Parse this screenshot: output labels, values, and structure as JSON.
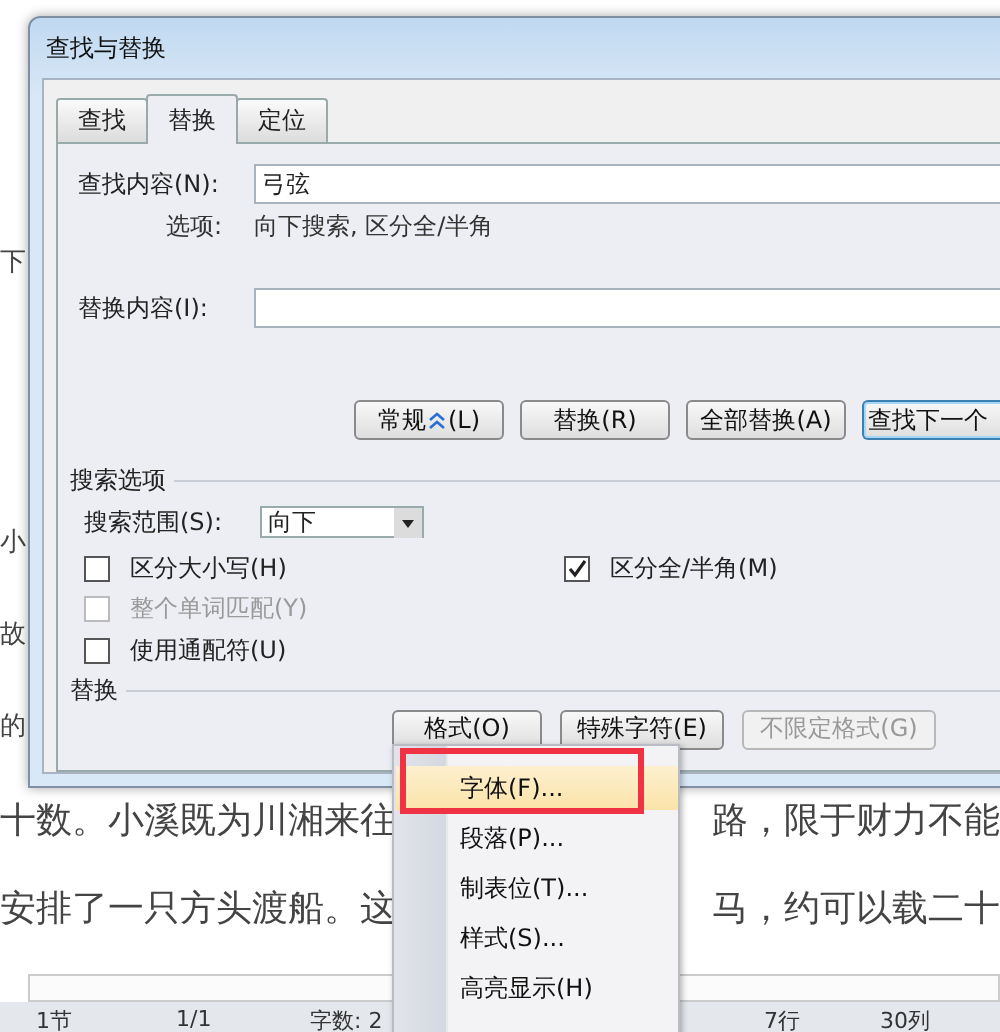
{
  "document": {
    "margin_chars": [
      "下",
      "小",
      "故",
      "的"
    ],
    "lines": [
      {
        "left": "十数。小溪既为川湘来往",
        "right": "路，限于财力不能"
      },
      {
        "left": "安排了一只方头渡船。这",
        "right": "马，约可以载二十"
      }
    ]
  },
  "status_bar": [
    "1节",
    "1/1",
    "字数: 2",
    "7行",
    "30列"
  ],
  "dialog": {
    "title": "查找与替换",
    "tabs": [
      {
        "label": "查找",
        "selected": false
      },
      {
        "label": "替换",
        "selected": true
      },
      {
        "label": "定位",
        "selected": false
      }
    ],
    "find": {
      "label": "查找内容(N):",
      "value": "弓弦"
    },
    "options": {
      "label": "选项:",
      "value": "向下搜索, 区分全/半角"
    },
    "replace": {
      "label": "替换内容(I):"
    },
    "buttons": [
      {
        "kind": "less",
        "label": "常规",
        "mnemonic": "(L)",
        "disabled": false
      },
      {
        "kind": "plain",
        "label": "替换(R)",
        "disabled": false
      },
      {
        "kind": "plain",
        "label": "全部替换(A)",
        "disabled": false
      },
      {
        "kind": "default",
        "label": "查找下一个",
        "disabled": false
      }
    ],
    "search_options": {
      "title": "搜索选项",
      "scope_label": "搜索范围(S):",
      "scope_value": "向下",
      "checkboxes_left": [
        {
          "label": "区分大小写(H)",
          "checked": false,
          "disabled": false
        },
        {
          "label": "整个单词匹配(Y)",
          "checked": false,
          "disabled": true
        },
        {
          "label": "使用通配符(U)",
          "checked": false,
          "disabled": false
        }
      ],
      "checkboxes_right": [
        {
          "label": "区分全/半角(M)",
          "checked": true,
          "disabled": false
        }
      ]
    },
    "replace_section": {
      "title": "替换",
      "buttons": [
        {
          "label": "格式(O)",
          "disabled": false
        },
        {
          "label": "特殊字符(E)",
          "disabled": false
        },
        {
          "label": "不限定格式(G)",
          "disabled": true
        }
      ]
    }
  },
  "format_menu": [
    {
      "label": "字体(F)...",
      "selected": true
    },
    {
      "label": "段落(P)...",
      "selected": false
    },
    {
      "label": "制表位(T)...",
      "selected": false
    },
    {
      "label": "样式(S)...",
      "selected": false
    },
    {
      "label": "高亮显示(H)",
      "selected": false
    }
  ]
}
